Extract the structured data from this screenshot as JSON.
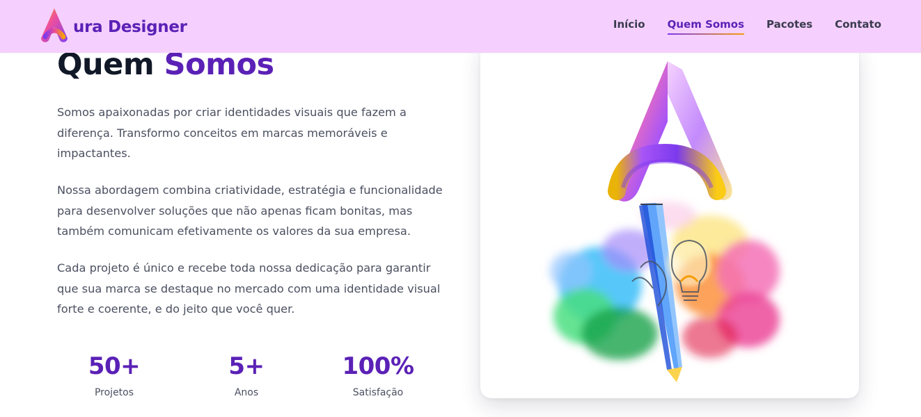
{
  "header": {
    "brand_text": "ura Designer",
    "brand_logo_icon": "letter-a-logo-icon",
    "nav": [
      {
        "label": "Início",
        "active": false
      },
      {
        "label": "Quem Somos",
        "active": true
      },
      {
        "label": "Pacotes",
        "active": false
      },
      {
        "label": "Contato",
        "active": false
      }
    ]
  },
  "main": {
    "title_part1": "Quem",
    "title_part2": "Somos",
    "paragraphs": [
      "Somos apaixonadas por criar identidades visuais que fazem a diferença. Transformo conceitos em marcas memoráveis e impactantes.",
      "Nossa abordagem combina criatividade, estratégia e funcionalidade para desenvolver soluções que não apenas ficam bonitas, mas também comunicam efetivamente os valores da sua empresa.",
      "Cada projeto é único e recebe toda nossa dedicação para garantir que sua marca se destaque no mercado com uma identidade visual forte e coerente, e do jeito que você quer."
    ],
    "stats": [
      {
        "value": "50+",
        "label": "Projetos"
      },
      {
        "value": "5+",
        "label": "Anos"
      },
      {
        "value": "100%",
        "label": "Satisfação"
      }
    ]
  },
  "card": {
    "image_icon": "letter-a-paint-splash-lightbulb-illustration"
  },
  "colors": {
    "header_bg": "#f5d0fe",
    "accent_purple": "#5b21b6",
    "text_dark": "#111827",
    "text_body": "#4b5060"
  }
}
